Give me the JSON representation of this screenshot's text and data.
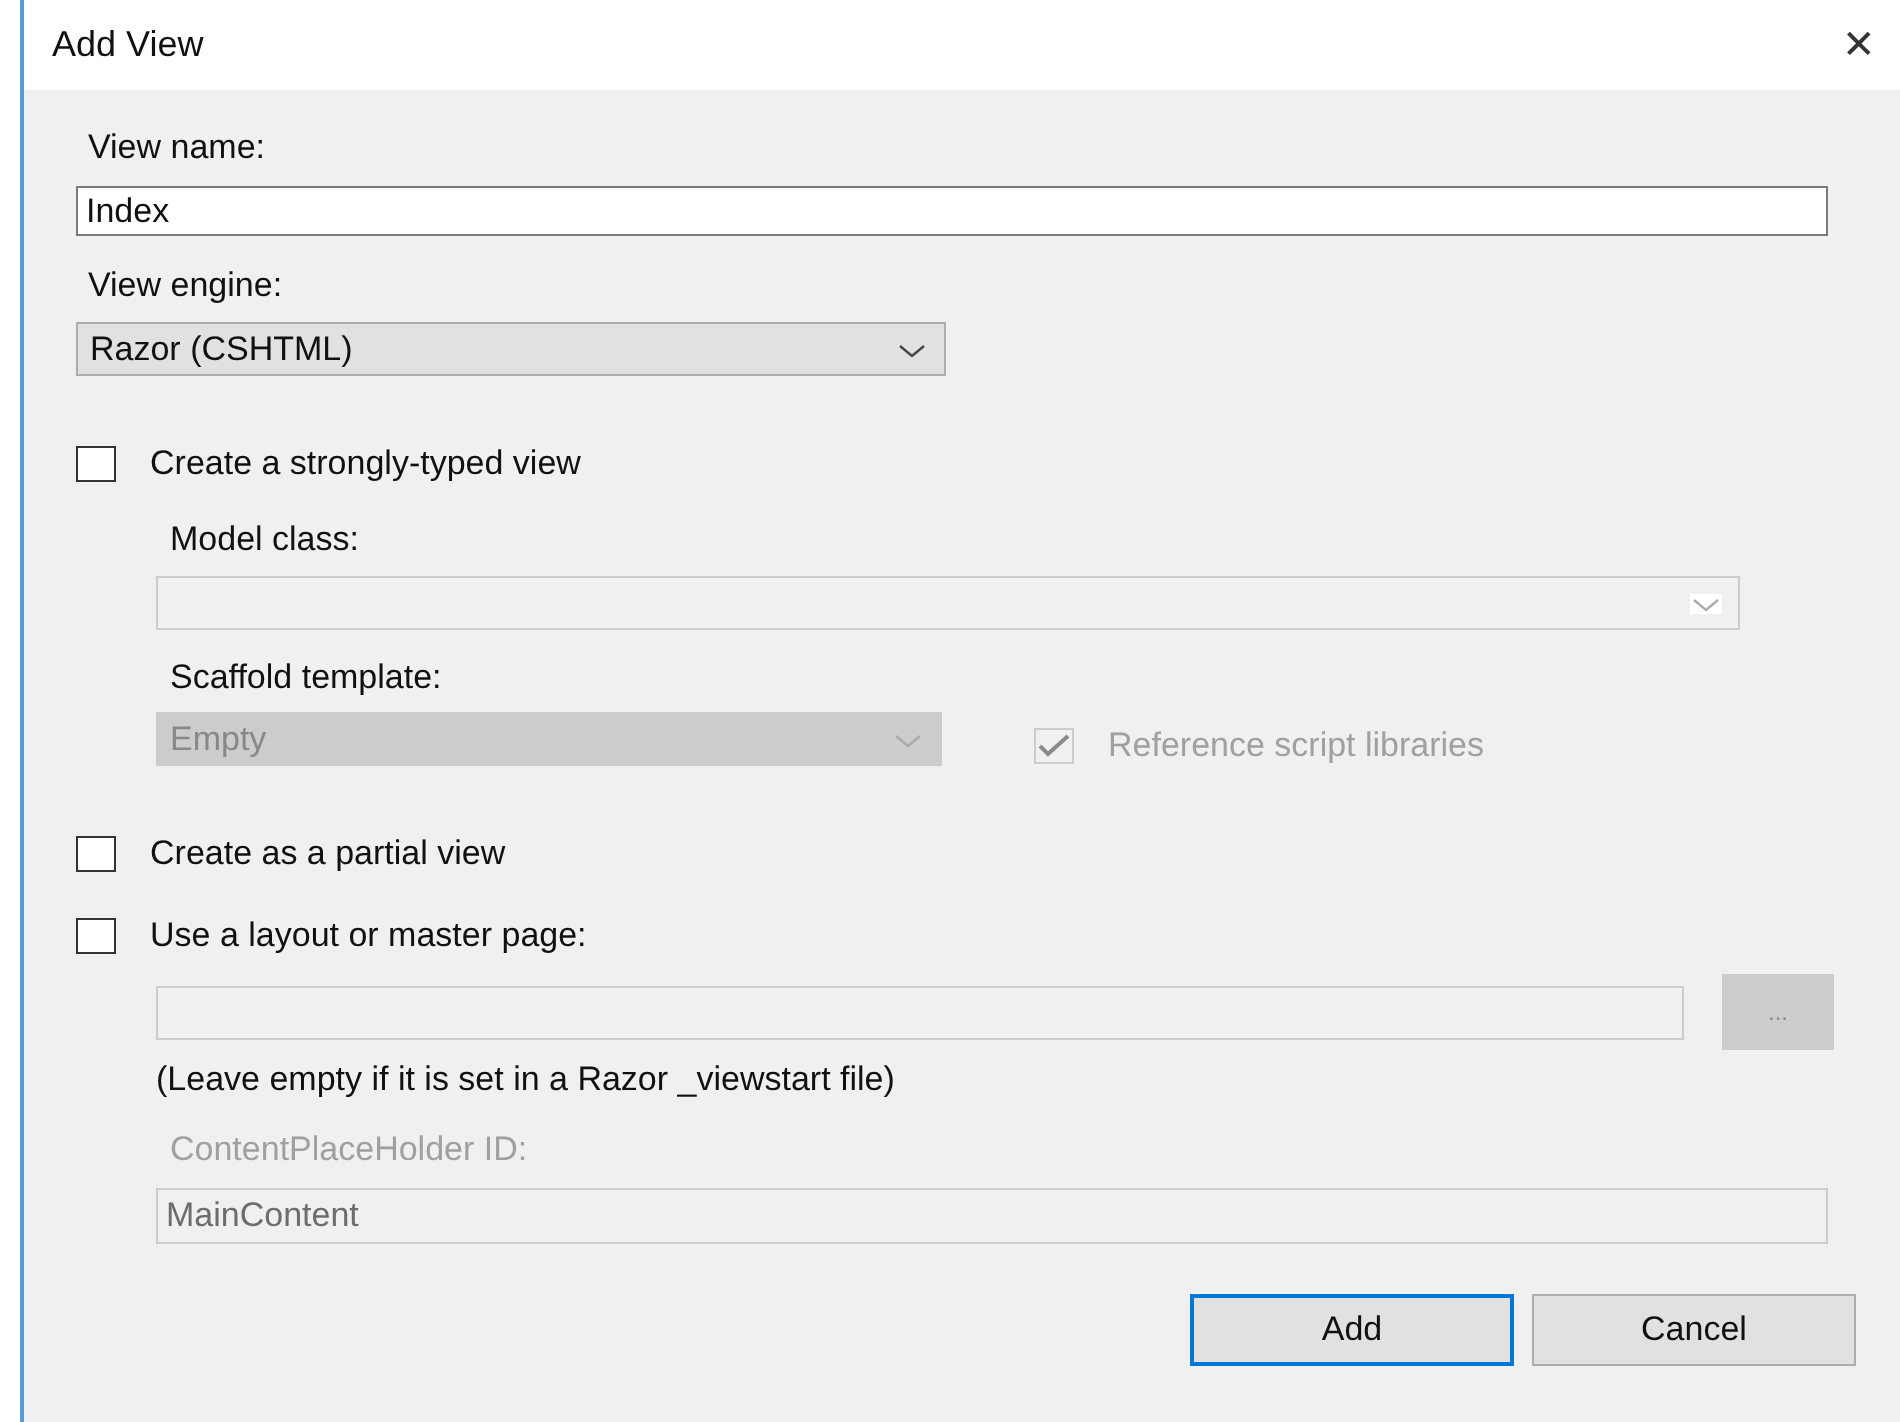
{
  "window": {
    "title": "Add View",
    "close": "✕"
  },
  "view_name": {
    "label": "View name:",
    "value": "Index"
  },
  "view_engine": {
    "label": "View engine:",
    "value": "Razor (CSHTML)",
    "disabled": false
  },
  "strongly_typed": {
    "label": "Create a strongly-typed view",
    "checked": false,
    "disabled": false
  },
  "model_class": {
    "label": "Model class:",
    "disabled": true
  },
  "scaffold_template": {
    "label": "Scaffold template:",
    "value": "Empty",
    "disabled": true
  },
  "reference_scripts": {
    "label": "Reference script libraries",
    "checked": true,
    "disabled": true
  },
  "partial_view": {
    "label": "Create as a partial view",
    "checked": false,
    "disabled": false
  },
  "use_layout": {
    "label": "Use a layout or master page:",
    "checked": false,
    "disabled": false
  },
  "layout_browse": {
    "label": "...",
    "disabled": true
  },
  "layout_note": "(Leave empty if it is set in a Razor _viewstart file)",
  "content_placeholder": {
    "label": "ContentPlaceHolder ID:",
    "value": "MainContent",
    "disabled": true
  },
  "buttons": [
    {
      "label": "Add",
      "default": true
    },
    {
      "label": "Cancel",
      "default": false
    }
  ]
}
